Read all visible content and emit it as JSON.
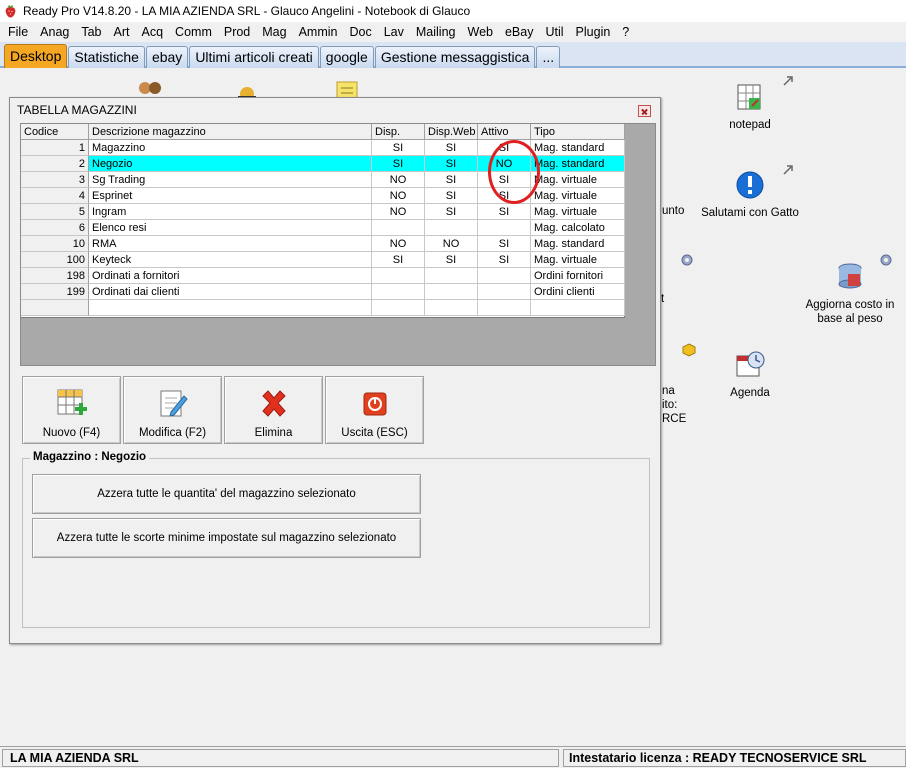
{
  "app_title": "Ready Pro V14.8.20 - LA MIA AZIENDA SRL - Glauco Angelini - Notebook di Glauco",
  "menu": [
    "File",
    "Anag",
    "Tab",
    "Art",
    "Acq",
    "Comm",
    "Prod",
    "Mag",
    "Ammin",
    "Doc",
    "Lav",
    "Mailing",
    "Web",
    "eBay",
    "Util",
    "Plugin",
    "?"
  ],
  "tabs": [
    {
      "label": "Desktop",
      "active": true
    },
    {
      "label": "Statistiche",
      "active": false
    },
    {
      "label": "ebay",
      "active": false
    },
    {
      "label": "Ultimi articoli creati",
      "active": false
    },
    {
      "label": "google",
      "active": false
    },
    {
      "label": "Gestione messaggistica",
      "active": false
    },
    {
      "label": "...",
      "active": false
    }
  ],
  "desktop": {
    "notepad_label": "notepad",
    "salutami_label": "Salutami con Gatto",
    "aggiorna_label": "Aggiorna costo in base al peso",
    "agenda_label": "Agenda",
    "partial_unto": "unto",
    "partial_t": "t",
    "partial_na": "na",
    "partial_ito": "ito:",
    "partial_rce": "RCE"
  },
  "window": {
    "title": "TABELLA MAGAZZINI",
    "columns": [
      "Codice",
      "Descrizione magazzino",
      "Disp.",
      "Disp.Web",
      "Attivo",
      "Tipo"
    ],
    "rows": [
      {
        "codice": "1",
        "descrizione": "Magazzino",
        "disp": "SI",
        "disp_web": "SI",
        "attivo": "SI",
        "tipo": "Mag. standard"
      },
      {
        "codice": "2",
        "descrizione": "Negozio",
        "disp": "SI",
        "disp_web": "SI",
        "attivo": "NO",
        "tipo": "Mag. standard"
      },
      {
        "codice": "3",
        "descrizione": "Sg Trading",
        "disp": "NO",
        "disp_web": "SI",
        "attivo": "SI",
        "tipo": "Mag. virtuale"
      },
      {
        "codice": "4",
        "descrizione": "Esprinet",
        "disp": "NO",
        "disp_web": "SI",
        "attivo": "SI",
        "tipo": "Mag. virtuale"
      },
      {
        "codice": "5",
        "descrizione": "Ingram",
        "disp": "NO",
        "disp_web": "SI",
        "attivo": "SI",
        "tipo": "Mag. virtuale"
      },
      {
        "codice": "6",
        "descrizione": "Elenco resi",
        "disp": "",
        "disp_web": "",
        "attivo": "",
        "tipo": "Mag. calcolato"
      },
      {
        "codice": "10",
        "descrizione": "RMA",
        "disp": "NO",
        "disp_web": "NO",
        "attivo": "SI",
        "tipo": "Mag. standard"
      },
      {
        "codice": "100",
        "descrizione": "Keyteck",
        "disp": "SI",
        "disp_web": "SI",
        "attivo": "SI",
        "tipo": "Mag. virtuale"
      },
      {
        "codice": "198",
        "descrizione": "Ordinati a fornitori",
        "disp": "",
        "disp_web": "",
        "attivo": "",
        "tipo": "Ordini fornitori"
      },
      {
        "codice": "199",
        "descrizione": "Ordinati dai clienti",
        "disp": "",
        "disp_web": "",
        "attivo": "",
        "tipo": "Ordini clienti"
      },
      {
        "codice": "",
        "descrizione": "",
        "disp": "",
        "disp_web": "",
        "attivo": "",
        "tipo": ""
      }
    ],
    "selected_row": 1,
    "buttons": {
      "nuovo": "Nuovo (F4)",
      "modifica": "Modifica (F2)",
      "elimina": "Elimina",
      "uscita": "Uscita (ESC)"
    },
    "group_title": "Magazzino : Negozio",
    "azzera_quantita": "Azzera tutte le quantita' del magazzino selezionato",
    "azzera_scorte": "Azzera tutte le scorte minime impostate sul magazzino selezionato"
  },
  "status": {
    "left": "LA MIA AZIENDA SRL",
    "right": "Intestatario licenza : READY TECNOSERVICE SRL"
  },
  "colors": {
    "selected_row": "#00ffff",
    "active_tab": "#f5a623",
    "highlight_circle": "#e02020"
  }
}
